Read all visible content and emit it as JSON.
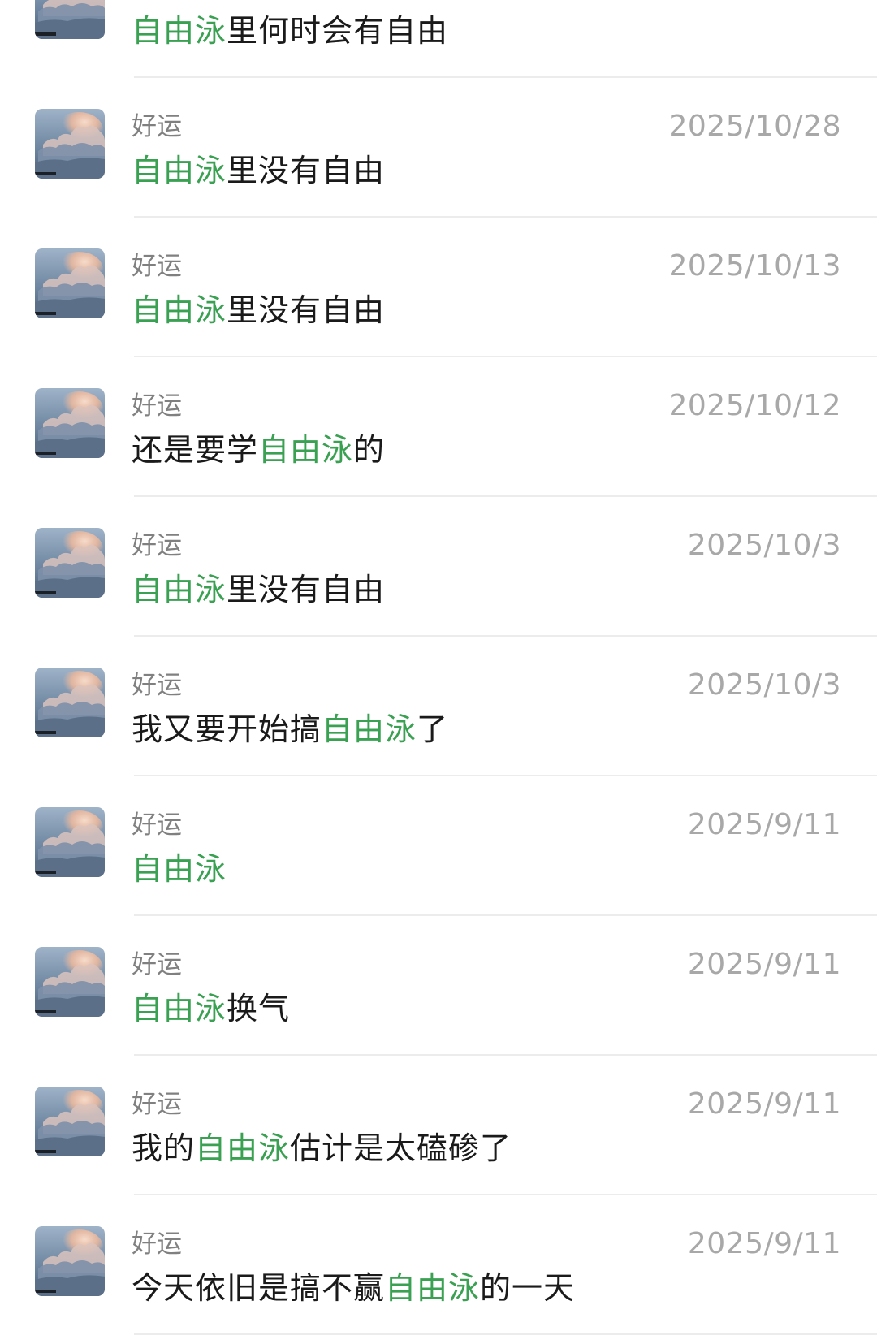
{
  "results": [
    {
      "name": "",
      "date": "",
      "message": {
        "before": "",
        "highlight": "自由泳",
        "after": "里何时会有自由"
      }
    },
    {
      "name": "好运",
      "date": "2025/10/28",
      "message": {
        "before": "",
        "highlight": "自由泳",
        "after": "里没有自由"
      }
    },
    {
      "name": "好运",
      "date": "2025/10/13",
      "message": {
        "before": "",
        "highlight": "自由泳",
        "after": "里没有自由"
      }
    },
    {
      "name": "好运",
      "date": "2025/10/12",
      "message": {
        "before": "还是要学",
        "highlight": "自由泳",
        "after": "的"
      }
    },
    {
      "name": "好运",
      "date": "2025/10/3",
      "message": {
        "before": "",
        "highlight": "自由泳",
        "after": "里没有自由"
      }
    },
    {
      "name": "好运",
      "date": "2025/10/3",
      "message": {
        "before": "我又要开始搞",
        "highlight": "自由泳",
        "after": "了"
      }
    },
    {
      "name": "好运",
      "date": "2025/9/11",
      "message": {
        "before": "",
        "highlight": "自由泳",
        "after": ""
      }
    },
    {
      "name": "好运",
      "date": "2025/9/11",
      "message": {
        "before": "",
        "highlight": "自由泳",
        "after": "换气"
      }
    },
    {
      "name": "好运",
      "date": "2025/9/11",
      "message": {
        "before": "我的",
        "highlight": "自由泳",
        "after": "估计是太磕碜了"
      }
    },
    {
      "name": "好运",
      "date": "2025/9/11",
      "message": {
        "before": "今天依旧是搞不赢",
        "highlight": "自由泳",
        "after": "的一天"
      }
    }
  ],
  "colors": {
    "highlight": "#3aa152",
    "name": "#808080",
    "date": "#a8a8a8",
    "divider": "#ececec"
  },
  "icons": {
    "avatar": "sky-clouds-avatar-icon"
  }
}
